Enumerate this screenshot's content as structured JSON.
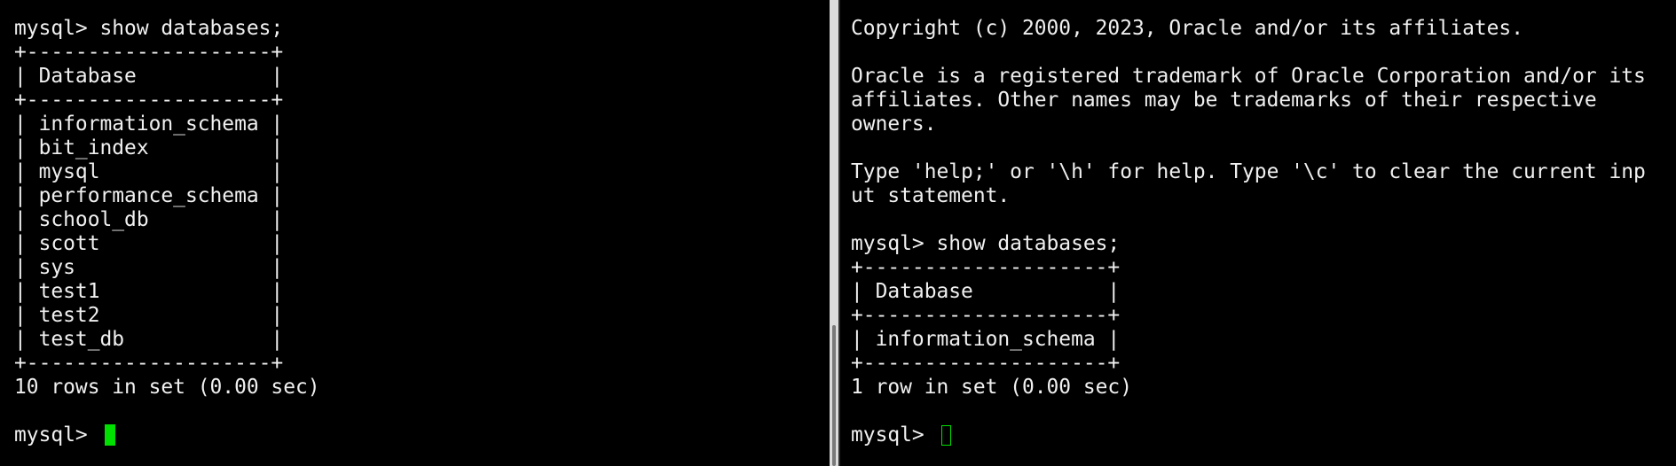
{
  "left_terminal": {
    "lines": [
      "mysql> show databases;",
      "+--------------------+",
      "| Database           |",
      "+--------------------+",
      "| information_schema |",
      "| bit_index          |",
      "| mysql              |",
      "| performance_schema |",
      "| school_db          |",
      "| scott              |",
      "| sys                |",
      "| test1              |",
      "| test2              |",
      "| test_db            |",
      "+--------------------+",
      "10 rows in set (0.00 sec)",
      ""
    ],
    "prompt": "mysql> ",
    "cursor_color": "#00e000"
  },
  "right_terminal": {
    "lines": [
      "Copyright (c) 2000, 2023, Oracle and/or its affiliates.",
      "",
      "Oracle is a registered trademark of Oracle Corporation and/or its",
      "affiliates. Other names may be trademarks of their respective",
      "owners.",
      "",
      "Type 'help;' or '\\h' for help. Type '\\c' to clear the current inp",
      "ut statement.",
      "",
      "mysql> show databases;",
      "+--------------------+",
      "| Database           |",
      "+--------------------+",
      "| information_schema |",
      "+--------------------+",
      "1 row in set (0.00 sec)",
      ""
    ],
    "prompt": "mysql> ",
    "cursor_color": "#00e000"
  },
  "colors": {
    "background": "#000000",
    "text": "#f0f0f0",
    "scrollbar_track": "#dcdcdc",
    "scrollbar_thumb": "#7a7a7a"
  }
}
